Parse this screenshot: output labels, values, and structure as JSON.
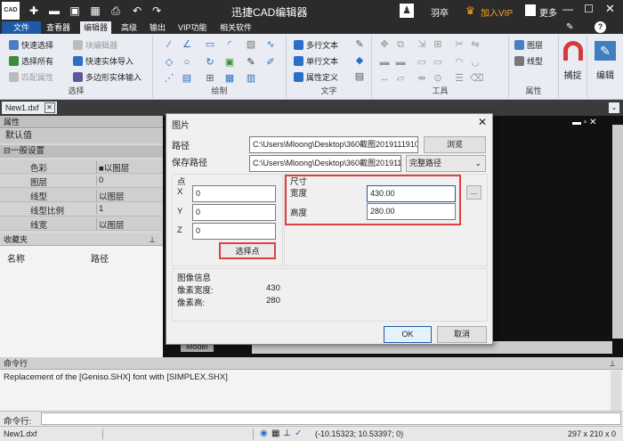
{
  "app": {
    "logo": "CAD",
    "title": "迅捷CAD编辑器",
    "user": "羽卒",
    "vip": "加入VIP",
    "more": "更多"
  },
  "menu": [
    "文件",
    "查看器",
    "编辑器",
    "高级",
    "输出",
    "VIP功能",
    "相关软件"
  ],
  "ribbon": {
    "select": {
      "label": "选择",
      "items": [
        "快速选择",
        "块编辑器",
        "选择所有",
        "快速实体导入",
        "匹配属性",
        "多边形实体输入"
      ]
    },
    "draw": {
      "label": "绘制"
    },
    "text": {
      "label": "文字",
      "items": [
        "多行文本",
        "单行文本",
        "属性定义"
      ]
    },
    "tools": {
      "label": "工具"
    },
    "props": {
      "label": "属性",
      "items": [
        "图层",
        "线型"
      ]
    },
    "snap": "捕捉",
    "edit": "编辑"
  },
  "doc_tab": "New1.dxf",
  "properties": {
    "title": "属性",
    "default": "默认值",
    "section": "一般设置",
    "rows": [
      {
        "k": "色彩",
        "v": "■以图层"
      },
      {
        "k": "图层",
        "v": "0"
      },
      {
        "k": "线型",
        "v": "以图层"
      },
      {
        "k": "线型比例",
        "v": "1"
      },
      {
        "k": "线宽",
        "v": "以图层"
      }
    ]
  },
  "favorites": {
    "title": "收藏夹",
    "col_name": "名称",
    "col_path": "路径"
  },
  "model_tab": "Model",
  "command": {
    "title": "命令行",
    "log": "Replacement of the [Geniso.SHX] font with [SIMPLEX.SHX]",
    "prompt": "命令行:"
  },
  "status": {
    "file": "New1.dxf",
    "coords": "(-10.15323; 10.53397; 0)",
    "size": "297 x 210 x 0"
  },
  "dialog": {
    "title": "图片",
    "path_label": "路径",
    "path_value": "C:\\Users\\Mloong\\Desktop\\360截图20191119100",
    "browse": "浏览",
    "save_label": "保存路径",
    "save_value": "C:\\Users\\Mloong\\Desktop\\360截图20191119",
    "save_mode": "完整路径",
    "point": {
      "label": "点",
      "x_label": "X",
      "x": "0",
      "y_label": "Y",
      "y": "0",
      "z_label": "Z",
      "z": "0",
      "pick": "选择点"
    },
    "size": {
      "label": "尺寸",
      "w_label": "宽度",
      "w": "430.00",
      "h_label": "高度",
      "h": "280.00",
      "more": "..."
    },
    "info": {
      "label": "图像信息",
      "pw_label": "像素宽度:",
      "pw": "430",
      "ph_label": "像素高:",
      "ph": "280"
    },
    "ok": "OK",
    "cancel": "取消"
  },
  "colors": {
    "accent": "#1e5aa8",
    "highlight": "#e04040",
    "vip": "#f5a623"
  }
}
